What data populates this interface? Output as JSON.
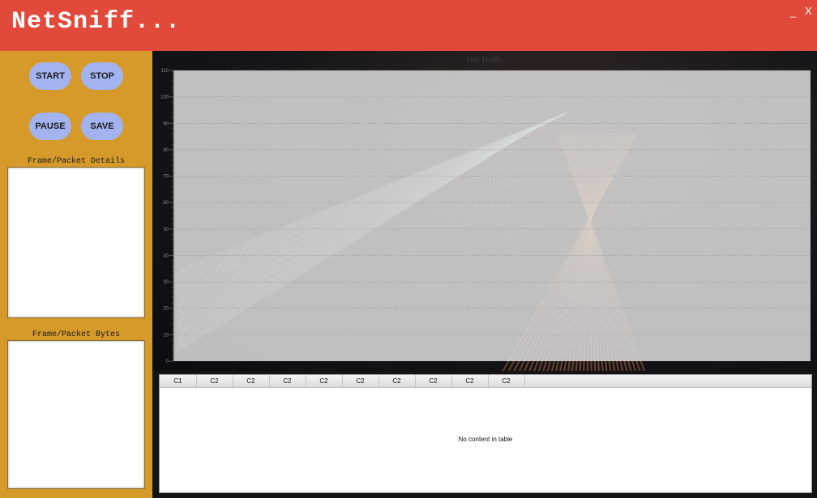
{
  "header": {
    "title": "NetSniff...",
    "minimize_label": "_",
    "close_label": "X"
  },
  "controls": {
    "start_label": "START",
    "stop_label": "STOP",
    "pause_label": "PAUSE",
    "save_label": "SAVE"
  },
  "panels": {
    "details_label": "Frame/Packet Details",
    "bytes_label": "Frame/Packet Bytes"
  },
  "chart_data": {
    "type": "line",
    "title": "Net Traffic",
    "xlabel": "",
    "ylabel": "",
    "ylim": [
      0,
      110
    ],
    "y_ticks": [
      0,
      10,
      20,
      30,
      40,
      50,
      60,
      70,
      80,
      90,
      100,
      110
    ],
    "series": [],
    "grid": true
  },
  "table": {
    "columns": [
      "C1",
      "C2",
      "C2",
      "C2",
      "C2",
      "C2",
      "C2",
      "C2",
      "C2",
      "C2"
    ],
    "rows": [],
    "empty_message": "No content in table"
  }
}
